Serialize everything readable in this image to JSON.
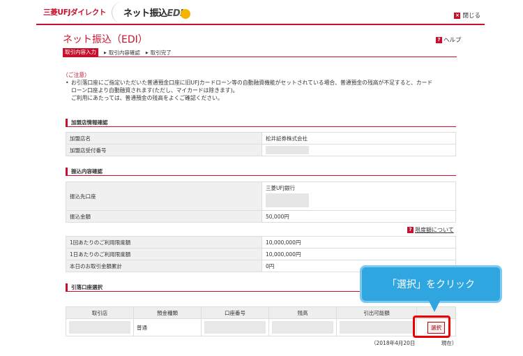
{
  "header": {
    "brand": "三菱UFJダイレクト",
    "logo_text": "ネット振込",
    "logo_suffix": "EDI",
    "close_label": "閉じる"
  },
  "page": {
    "title": "ネット振込（EDI）",
    "help_label": "ヘルプ"
  },
  "steps": [
    "取引内容入力",
    "取引内容確認",
    "取引完了"
  ],
  "notice": {
    "title": "（ご注意）",
    "lines": [
      "お引落口座にご指定いただいた普通預金口座に旧UFJカードローン等の自動融資機能がセットされている場合、普通預金の残高が不足すると、カード",
      "ローン口座より自動融資されます(ただし、マイカードは除きます)。",
      "ご利用にあたっては、普通預金の残高をよくご確認ください。"
    ]
  },
  "merchant": {
    "section_title": "加盟店情報確認",
    "rows": [
      {
        "label": "加盟店名",
        "value": "松井証券株式会社"
      },
      {
        "label": "加盟店受付番号",
        "value": ""
      }
    ]
  },
  "transfer": {
    "section_title": "振込内容確認",
    "dest_label": "振込先口座",
    "dest_bank": "三菱UFJ銀行",
    "amount_label": "振込金額",
    "amount": "50,000円"
  },
  "limits": {
    "link_label": "限度額について",
    "rows": [
      {
        "label": "1回あたりのご利用限度額",
        "value": "10,000,000円"
      },
      {
        "label": "1日あたりのご利用限度額",
        "value": "10,000,000円"
      },
      {
        "label": "本日のお取引金額累計",
        "value": "0円"
      }
    ]
  },
  "account": {
    "section_title": "引落口座選択",
    "columns": [
      "取引店",
      "預金種類",
      "口座番号",
      "残高",
      "引出可能額",
      ""
    ],
    "row": {
      "type": "普通",
      "select_label": "選択"
    }
  },
  "callout": {
    "text": "「選択」をクリック"
  },
  "footer": {
    "date_note": "（2018年4月20日　　　　　現在）"
  },
  "colors": {
    "accent": "#c8102e",
    "callout": "#2fa6e0"
  }
}
